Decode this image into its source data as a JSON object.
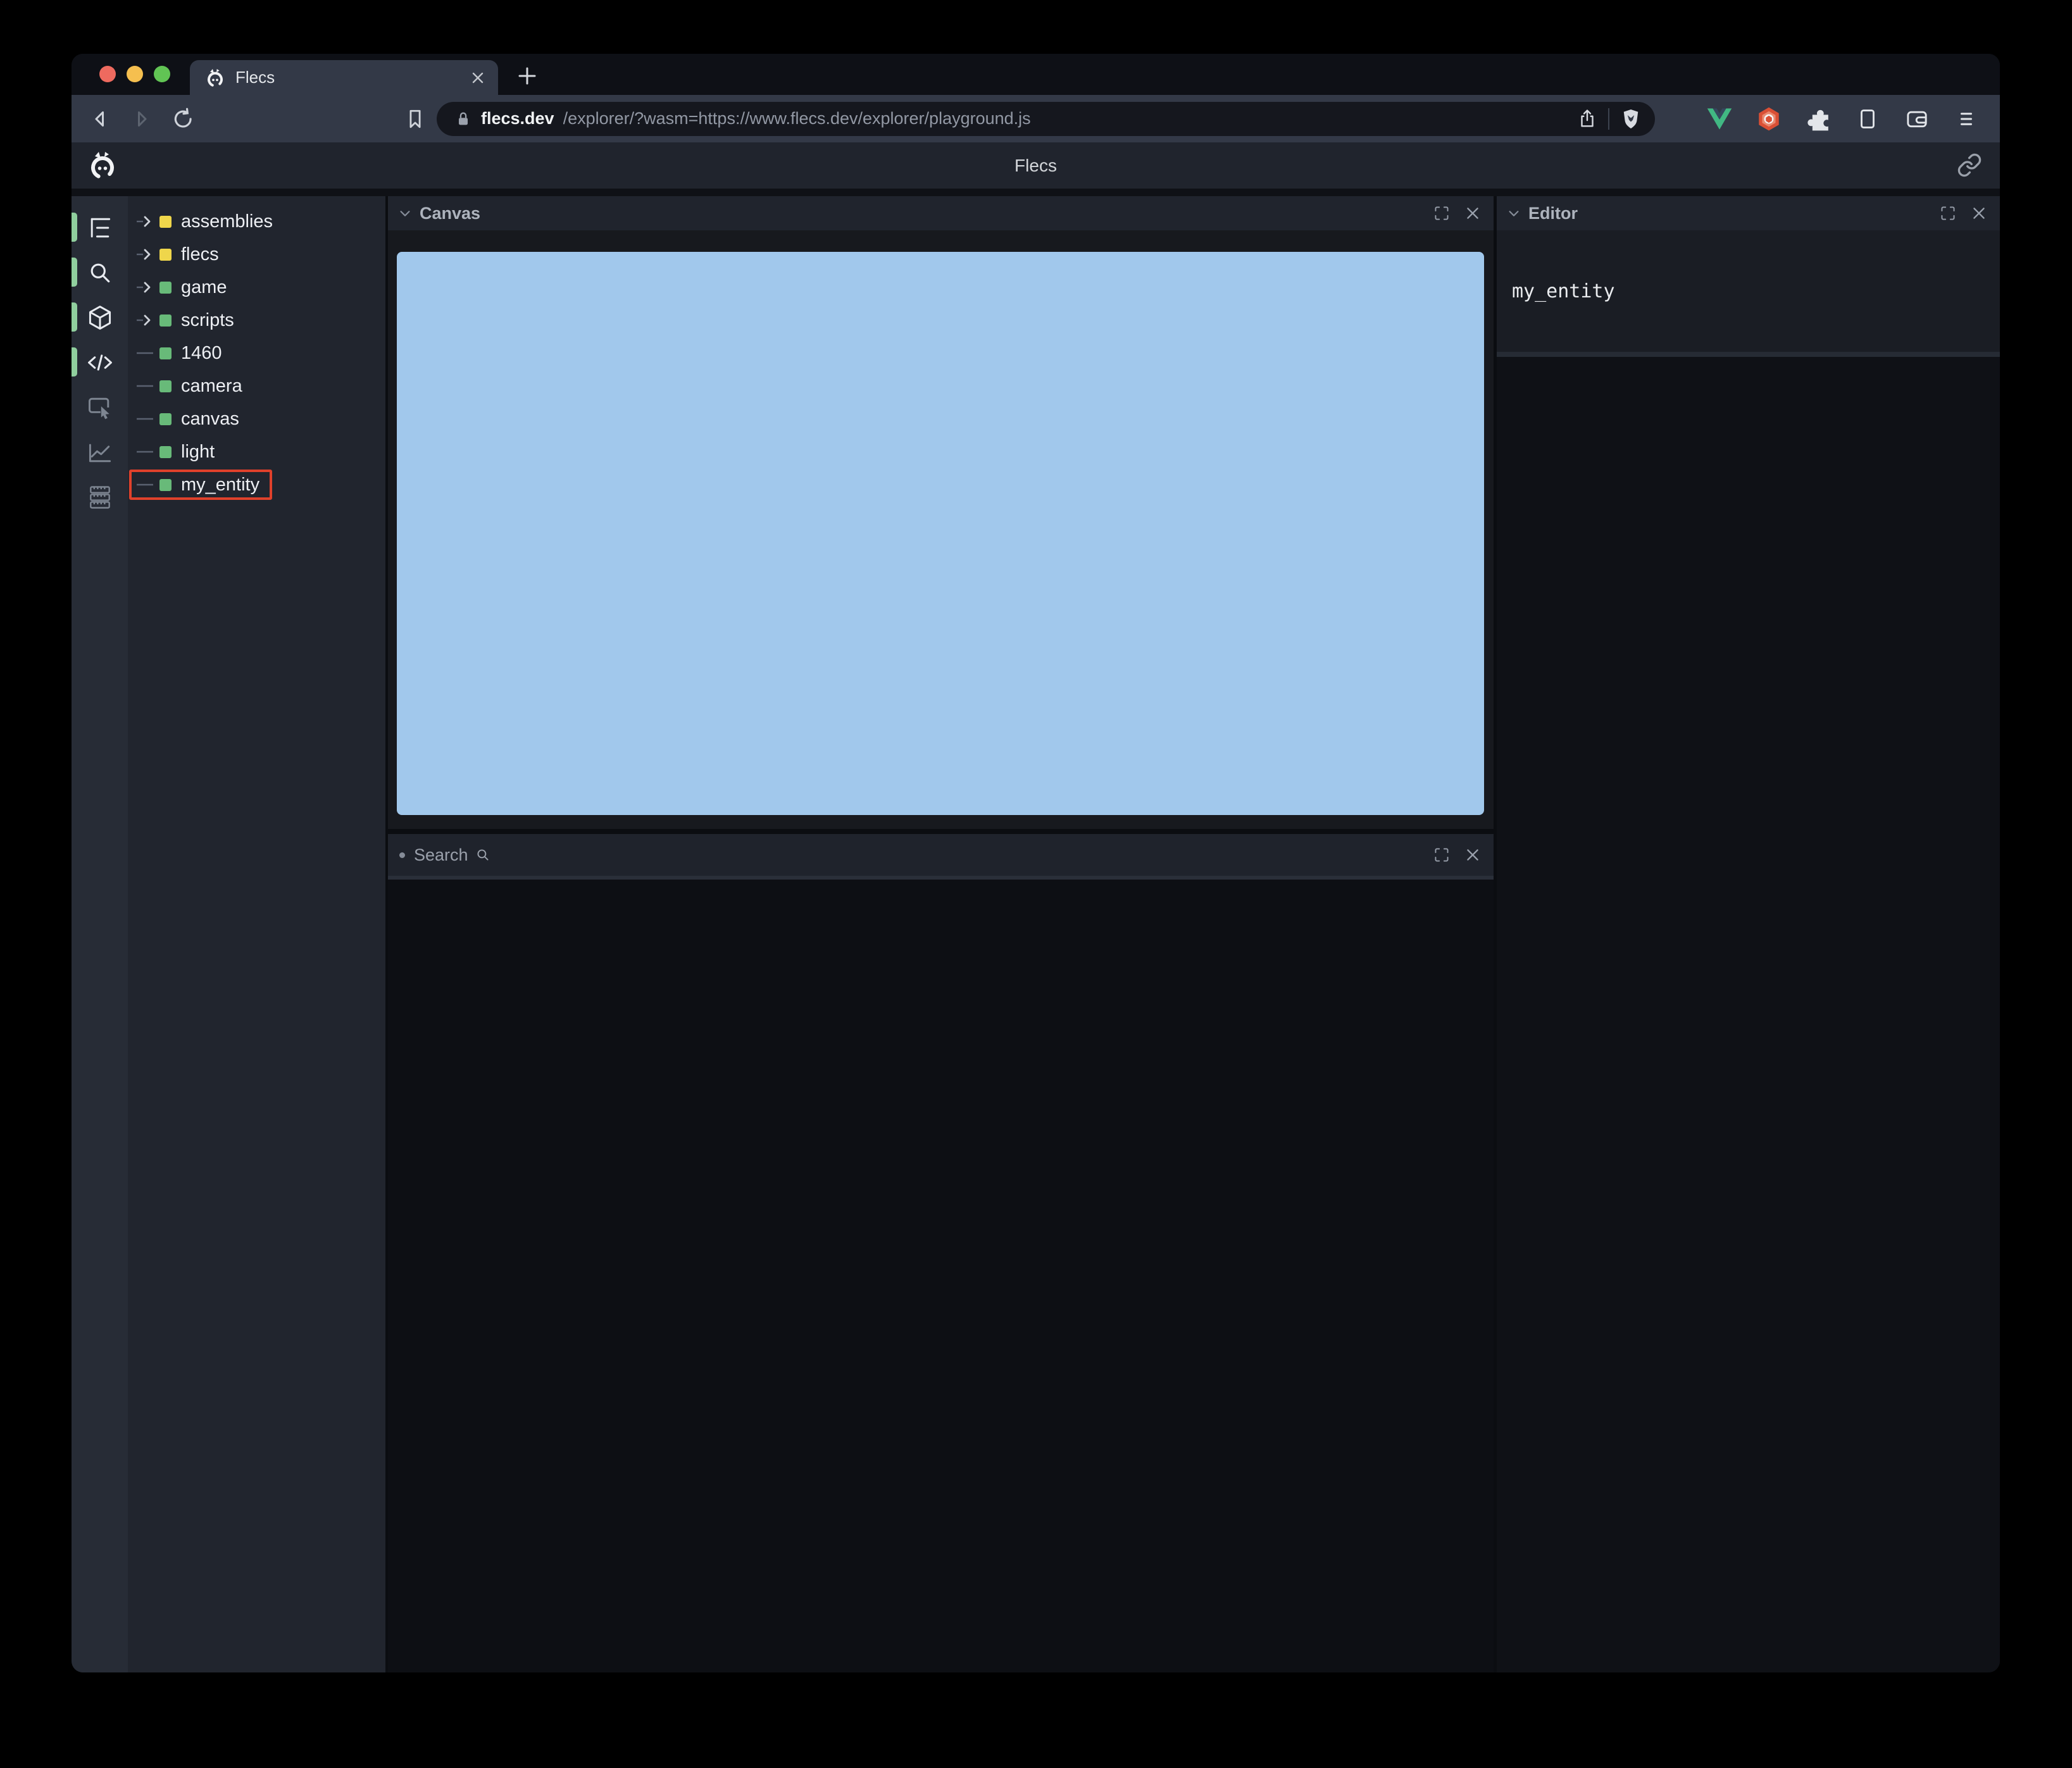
{
  "browser": {
    "tab_title": "Flecs",
    "url_domain": "flecs.dev",
    "url_path": "/explorer/?wasm=https://www.flecs.dev/explorer/playground.js"
  },
  "app": {
    "title": "Flecs"
  },
  "sidebar": {
    "icons": [
      {
        "name": "hierarchy-icon",
        "active": true
      },
      {
        "name": "search-icon",
        "active": true
      },
      {
        "name": "cube-icon",
        "active": true
      },
      {
        "name": "code-icon",
        "active": true
      },
      {
        "name": "inspect-icon",
        "active": false
      },
      {
        "name": "chart-icon",
        "active": false
      },
      {
        "name": "memory-icon",
        "active": false
      }
    ]
  },
  "tree": {
    "items": [
      {
        "label": "assemblies",
        "kind": "folder",
        "color": "yellow",
        "selected": false
      },
      {
        "label": "flecs",
        "kind": "folder",
        "color": "yellow",
        "selected": false
      },
      {
        "label": "game",
        "kind": "folder",
        "color": "green",
        "selected": false
      },
      {
        "label": "scripts",
        "kind": "folder",
        "color": "green",
        "selected": false
      },
      {
        "label": "1460",
        "kind": "leaf",
        "color": "green",
        "selected": false
      },
      {
        "label": "camera",
        "kind": "leaf",
        "color": "green",
        "selected": false
      },
      {
        "label": "canvas",
        "kind": "leaf",
        "color": "green",
        "selected": false
      },
      {
        "label": "light",
        "kind": "leaf",
        "color": "green",
        "selected": false
      },
      {
        "label": "my_entity",
        "kind": "leaf",
        "color": "green",
        "selected": true
      }
    ]
  },
  "panels": {
    "canvas": {
      "title": "Canvas"
    },
    "search": {
      "title": "Search"
    },
    "editor": {
      "title": "Editor",
      "content": "my_entity"
    }
  },
  "colors": {
    "canvas_blue": "#a1c8ec",
    "selection_red": "#e0412b",
    "folder_yellow": "#efd64b",
    "entity_green": "#68ba79",
    "active_pill_green": "#90cf9e",
    "traffic_red": "#ee6a5f",
    "traffic_yellow": "#f5bf4f",
    "traffic_green": "#61c454"
  }
}
